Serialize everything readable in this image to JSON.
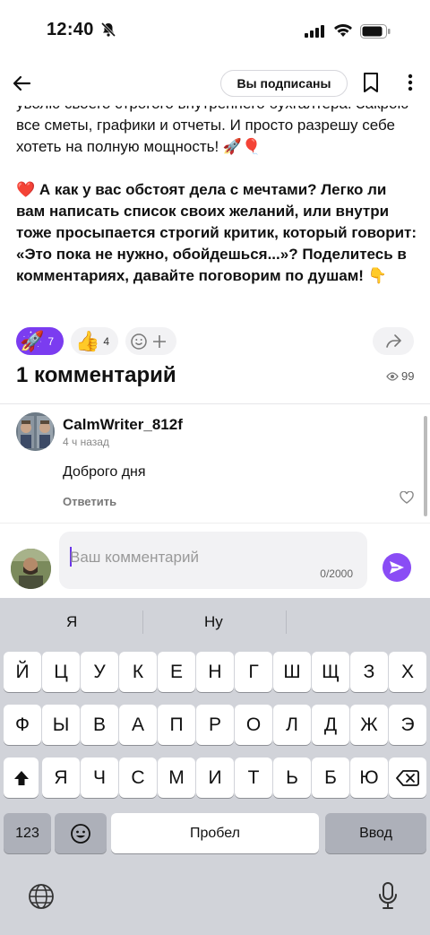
{
  "status_bar": {
    "time": "12:40"
  },
  "header": {
    "subscribed_label": "Вы подписаны"
  },
  "post": {
    "paragraph1": "уволю своего строгого внутреннего бухгалтера. Закрою все сметы, графики и отчеты. И просто разрешу себе хотеть на полную мощность! 🚀🎈",
    "question": "❤️ А как у вас обстоят дела с мечтами? Легко ли вам написать список своих желаний, или внутри тоже просыпается строгий критик, который говорит: «Это пока не нужно, обойдешься...»? Поделитесь в комментариях, давайте поговорим по душам! 👇"
  },
  "reactions": {
    "items": [
      {
        "emoji": "🚀",
        "count": "7"
      },
      {
        "emoji": "👍",
        "count": "4"
      }
    ]
  },
  "comments": {
    "title": "1 комментарий",
    "views": "99",
    "list": [
      {
        "author": "CalmWriter_812f",
        "time": "4 ч назад",
        "text": "Доброго дня",
        "reply_label": "Ответить"
      }
    ]
  },
  "composer": {
    "placeholder": "Ваш комментарий",
    "counter": "0/2000"
  },
  "keyboard": {
    "suggestions": [
      "Я",
      "Ну",
      ""
    ],
    "row1": [
      "Й",
      "Ц",
      "У",
      "К",
      "Е",
      "Н",
      "Г",
      "Ш",
      "Щ",
      "З",
      "Х"
    ],
    "row2": [
      "Ф",
      "Ы",
      "В",
      "А",
      "П",
      "Р",
      "О",
      "Л",
      "Д",
      "Ж",
      "Э"
    ],
    "row3": [
      "Я",
      "Ч",
      "С",
      "М",
      "И",
      "Т",
      "Ь",
      "Б",
      "Ю"
    ],
    "numbers_label": "123",
    "space_label": "Пробел",
    "enter_label": "Ввод"
  },
  "colors": {
    "accent": "#7b3cf0",
    "keyboard_bg": "#d1d3d9"
  }
}
